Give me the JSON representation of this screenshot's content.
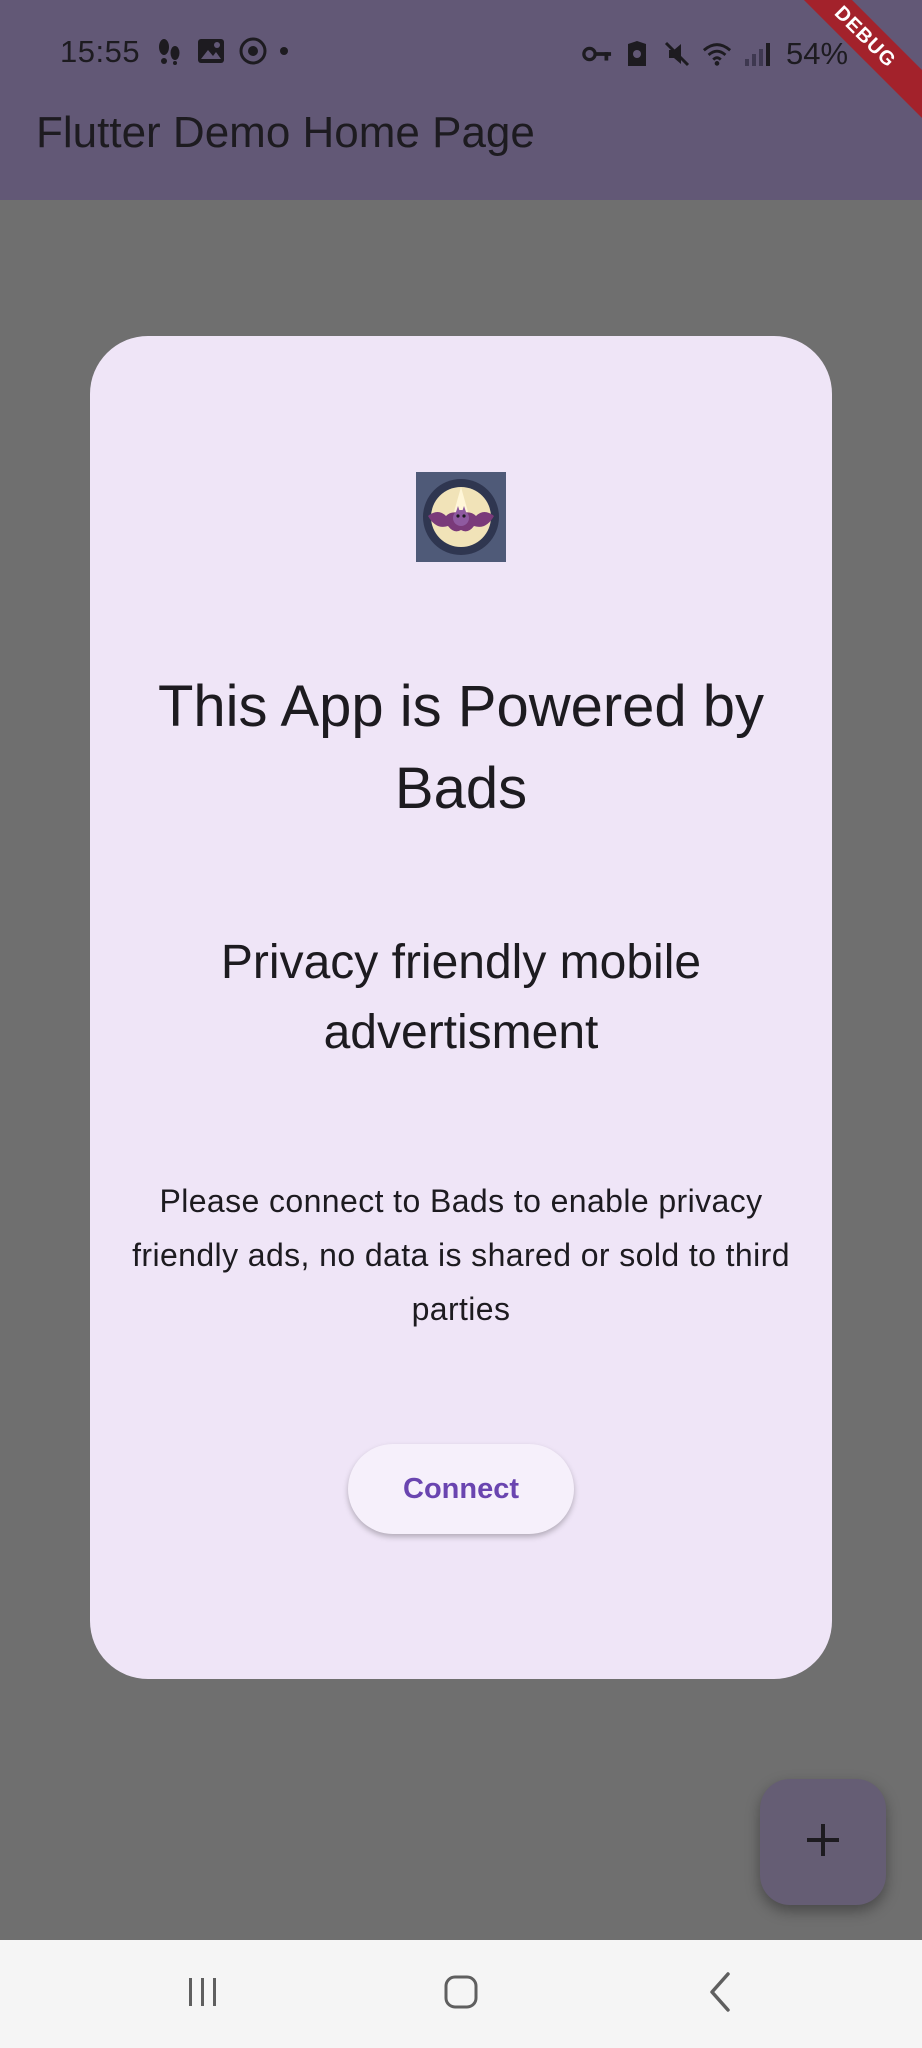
{
  "status_bar": {
    "time": "15:55",
    "battery": "54%",
    "left_icons": [
      "steps-icon",
      "gallery-icon",
      "vpn-icon",
      "more-dot"
    ],
    "right_icons": [
      "key-icon",
      "shield-icon",
      "mute-icon",
      "wifi-icon",
      "signal-icon"
    ]
  },
  "app_bar": {
    "title": "Flutter Demo Home Page"
  },
  "debug_banner": {
    "label": "DEBUG"
  },
  "dialog": {
    "logo_icon": "bat-logo-icon",
    "title": "This App is Powered by Bads",
    "subtitle": "Privacy friendly mobile advertisment",
    "body": "Please connect to Bads to enable privacy friendly ads, no data is shared or sold to third parties",
    "connect_label": "Connect"
  },
  "fab": {
    "icon": "plus-icon"
  },
  "nav_bar": {
    "buttons": [
      "recent-apps-icon",
      "home-icon",
      "back-icon"
    ]
  },
  "colors": {
    "scrim": "#6f6f6f",
    "app_bar": "#625876",
    "dialog_bg": "#efe5f7",
    "button_text": "#6a45b0",
    "debug": "#a3222b"
  }
}
